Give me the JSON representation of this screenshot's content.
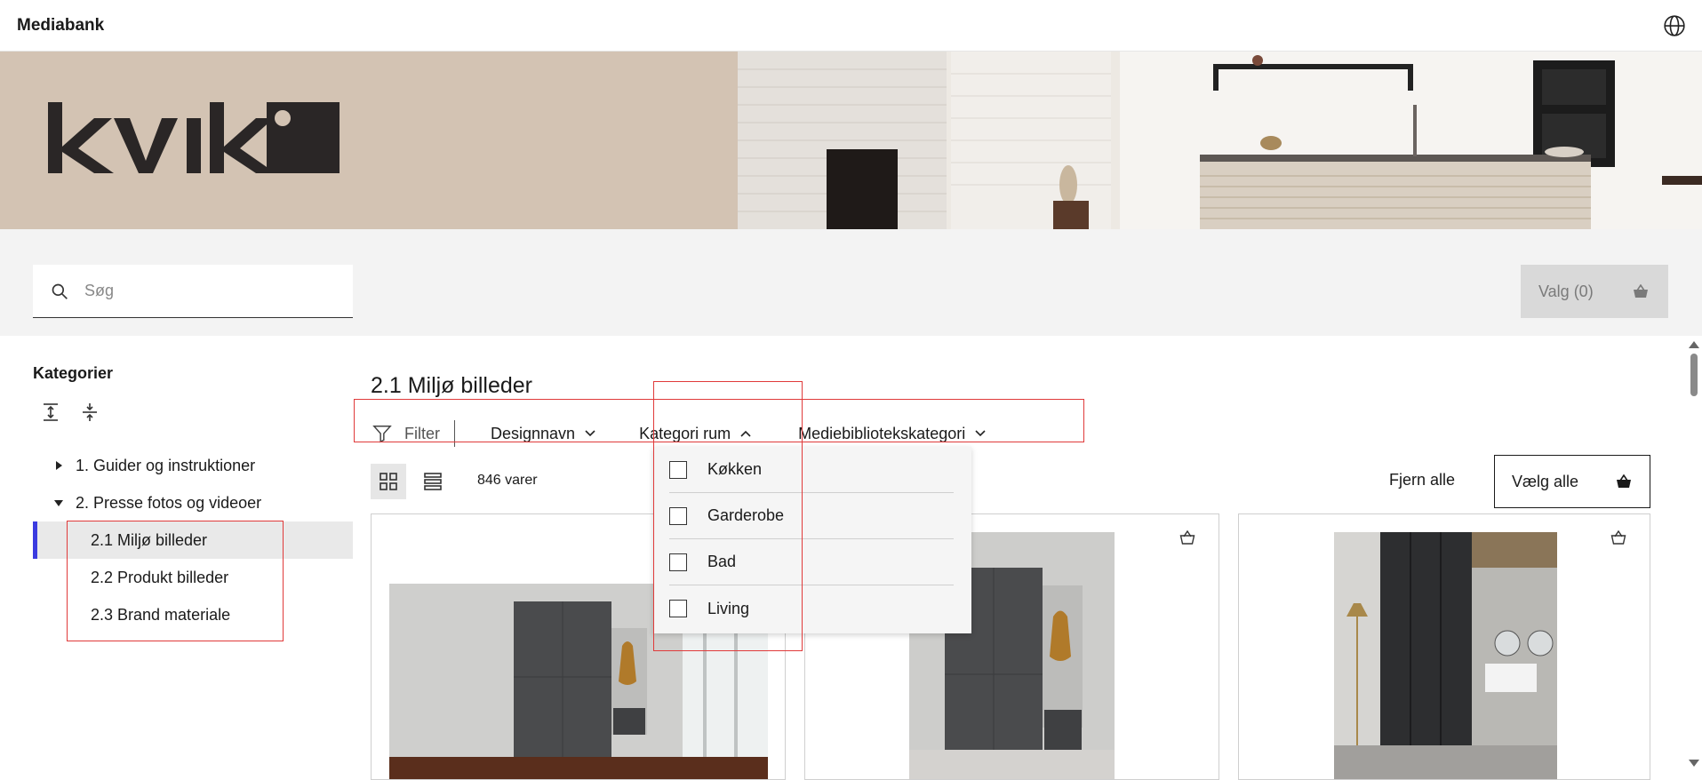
{
  "app": {
    "title": "Mediabank"
  },
  "brand": {
    "logo_text": "kvik",
    "bg_color": "#d3c3b3"
  },
  "search": {
    "placeholder": "Søg"
  },
  "selection": {
    "label": "Valg (0)"
  },
  "sidebar": {
    "title": "Kategorier",
    "tree": [
      {
        "label": "1. Guider og instruktioner",
        "expanded": false
      },
      {
        "label": "2. Presse fotos og videoer",
        "expanded": true,
        "children": [
          {
            "label": "2.1 Miljø billeder",
            "active": true
          },
          {
            "label": "2.2 Produkt billeder"
          },
          {
            "label": "2.3 Brand materiale"
          }
        ]
      }
    ]
  },
  "main": {
    "title": "2.1 Miljø billeder",
    "filter_label": "Filter",
    "filters": [
      "Designnavn",
      "Kategori rum",
      "Mediebibliotekskategori"
    ],
    "count": "846 varer",
    "remove_all": "Fjern alle",
    "select_all": "Vælg alle"
  },
  "dropdown": {
    "options": [
      "Køkken",
      "Garderobe",
      "Bad",
      "Living"
    ]
  },
  "colors": {
    "accent": "#3b3be0",
    "highlight": "#e03a3a"
  }
}
